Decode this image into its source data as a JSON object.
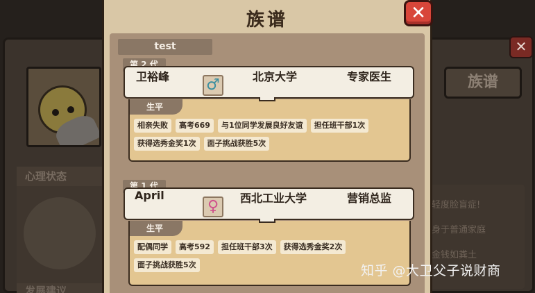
{
  "background": {
    "tab_label": "族谱",
    "mental_heading": "心理状态",
    "dev_heading": "发展建议",
    "side_lines": [
      "轻度脸盲症!",
      "身于普通家庭",
      "金钱如粪土"
    ],
    "watermark": "知乎 @大卫父子说财商"
  },
  "dialog": {
    "title": "族谱",
    "close_icon": "close-x-icon",
    "player_name": "test",
    "life_label": "生平",
    "generations": [
      {
        "label": "第 2 代",
        "name": "卫裕峰",
        "gender": "male",
        "gender_symbol": "♂",
        "gender_color": "#3a8fa0",
        "university": "北京大学",
        "occupation": "专家医生",
        "events": [
          "相亲失败",
          "高考669",
          "与1位同学发展良好友谊",
          "担任班干部1次",
          "获得选秀金奖1次",
          "面子挑战获胜5次"
        ]
      },
      {
        "label": "第 1 代",
        "name": "April",
        "gender": "female",
        "gender_symbol": "♀",
        "gender_color": "#d0508c",
        "university": "西北工业大学",
        "occupation": "营销总监",
        "events": [
          "配偶同学",
          "高考592",
          "担任班干部3次",
          "获得选秀金奖2次",
          "面子挑战获胜5次"
        ]
      }
    ]
  }
}
